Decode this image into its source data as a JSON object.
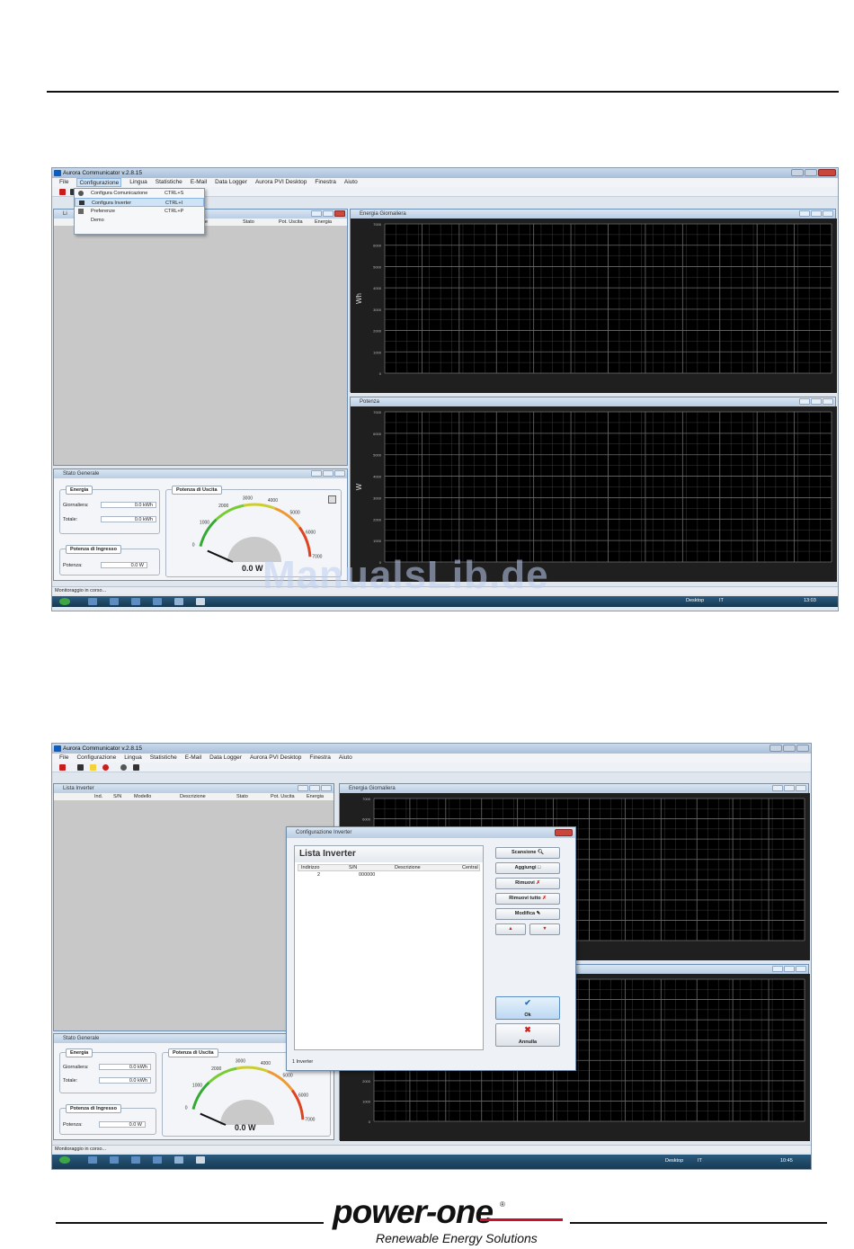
{
  "screenshot1": {
    "app_title": "Aurora Communicator v.2.8.15",
    "menu": [
      "File",
      "Configurazione",
      "Lingua",
      "Statistiche",
      "E-Mail",
      "Data Logger",
      "Aurora PVI Desktop",
      "Finestra",
      "Aiuto"
    ],
    "config_menu": [
      {
        "label": "Configura Comunicazione",
        "shortcut": "CTRL+S"
      },
      {
        "label": "Configura Inverter",
        "shortcut": "CTRL+I"
      },
      {
        "label": "Preferenze",
        "shortcut": "CTRL+P"
      },
      {
        "label": "Demo",
        "shortcut": ""
      }
    ],
    "inverter_list_title": "Li",
    "inverter_list_columns": [
      "ne",
      "Stato",
      "Pot. Uscita",
      "Energia"
    ],
    "chart_energy_title": "Energia Giornaliera",
    "chart_power_title": "Potenza",
    "general_title": "Stato Generale",
    "statusbar": "Monitoraggio in corso...",
    "taskbar_right": [
      "Desktop",
      "IT",
      "13:03"
    ]
  },
  "screenshot2": {
    "app_title": "Aurora Communicator v.2.8.15",
    "menu": [
      "File",
      "Configurazione",
      "Lingua",
      "Statistiche",
      "E-Mail",
      "Data Logger",
      "Aurora PVI Desktop",
      "Finestra",
      "Aiuto"
    ],
    "inverter_list_title": "Lista Inverter",
    "inverter_list_columns": [
      "Ind.",
      "S/N",
      "Modello",
      "Descrizione",
      "Stato",
      "Pot. Uscita",
      "Energia"
    ],
    "chart_energy_title": "Energia Giornaliera",
    "general_title": "Stato Generale",
    "dialog": {
      "title": "Configurazione Inverter",
      "list_title": "Lista Inverter",
      "columns": [
        "Indirizzo",
        "S/N",
        "Descrizione",
        "Central"
      ],
      "row": {
        "address": "2",
        "sn": "000000"
      },
      "footer": "1 Inverter",
      "buttons": [
        "Scansione",
        "Aggiungi",
        "Rimuovi",
        "Rimuovi tutto",
        "Modifica"
      ],
      "ok": "Ok",
      "cancel": "Annulla"
    },
    "statusbar": "Monitoraggio in corso...",
    "taskbar_right": [
      "Desktop",
      "IT",
      "10:45"
    ]
  },
  "general_panel": {
    "energia": "Energia",
    "giornaliera": "Giornaliera:",
    "totale": "Totale:",
    "energy_value": "0.0 kWh",
    "total_value": "0.0 kWh",
    "potenza_uscita": "Potenza di Uscita",
    "potenza_ingresso": "Potenza di Ingresso",
    "potenza": "Potenza:",
    "input_value": "0.0 W",
    "gauge_value": "0.0 W",
    "gauge_ticks": [
      "0",
      "1000",
      "2000",
      "3000",
      "4000",
      "5000",
      "6000",
      "7000"
    ]
  },
  "chart_axes": {
    "energy_ylabel": "Wh",
    "power_ylabel": "W",
    "y_ticks": [
      "7000",
      "6000",
      "5000",
      "4000",
      "3000",
      "2000",
      "1000",
      "0"
    ]
  },
  "watermark": "ManualsLib.de",
  "footer_logo": {
    "brand": "power-one",
    "registered": "®",
    "tagline": "Renewable Energy Solutions"
  }
}
